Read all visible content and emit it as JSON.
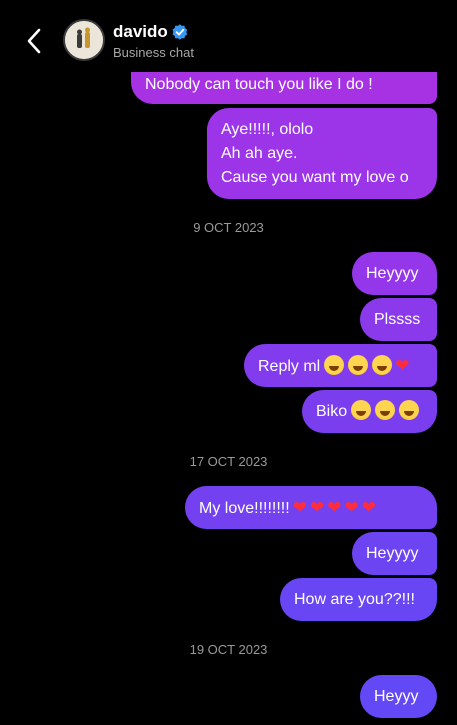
{
  "header": {
    "contact_name": "davido",
    "contact_sub": "Business chat",
    "verified_color": "#3897f0"
  },
  "colors": {
    "purple": "#a233e6",
    "violet": "#7c3ff0",
    "indigo": "#6b46f5",
    "background": "#000000"
  },
  "messages": {
    "m1": "Nobody can touch you like I do !",
    "m2_line1": "Aye!!!!!, ololo",
    "m2_line2": "Ah ah aye.",
    "m2_line3": "Cause you want my love o",
    "date1": "9 OCT 2023",
    "m3": "Heyyyy",
    "m4": "Plssss",
    "m5": "Reply ml",
    "m6": "Biko",
    "date2": "17 OCT 2023",
    "m7": "My love!!!!!!!!",
    "m8": "Heyyyy",
    "m9": "How are you??!!!",
    "date3": "19 OCT 2023",
    "m10": "Heyyy"
  }
}
